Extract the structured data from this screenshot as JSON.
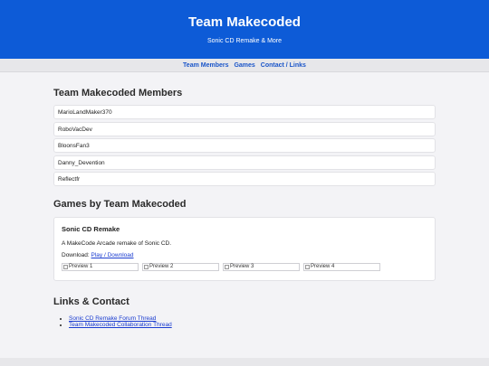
{
  "header": {
    "title": "Team Makecoded",
    "subtitle": "Sonic CD Remake & More",
    "bg_color": "#0d5bd7"
  },
  "nav": {
    "items": [
      "Team Members",
      "Games",
      "Contact / Links"
    ]
  },
  "members": {
    "heading": "Team Makecoded Members",
    "list": [
      "MarioLandMaker370",
      "RoboVacDev",
      "BloonsFan3",
      "Danny_Devention",
      "Reflectfr"
    ]
  },
  "games": {
    "heading": "Games by Team Makecoded",
    "card": {
      "title": "Sonic CD Remake",
      "description": "A MakeCode Arcade remake of Sonic CD.",
      "download_label": "Download:",
      "download_link": "Play / Download",
      "previews": [
        "Preview 1",
        "Preview 2",
        "Preview 3",
        "Preview 4"
      ]
    }
  },
  "links": {
    "heading": "Links & Contact",
    "items": [
      "Sonic CD Remake Forum Thread",
      "Team Makecoded Collaboration Thread"
    ]
  }
}
